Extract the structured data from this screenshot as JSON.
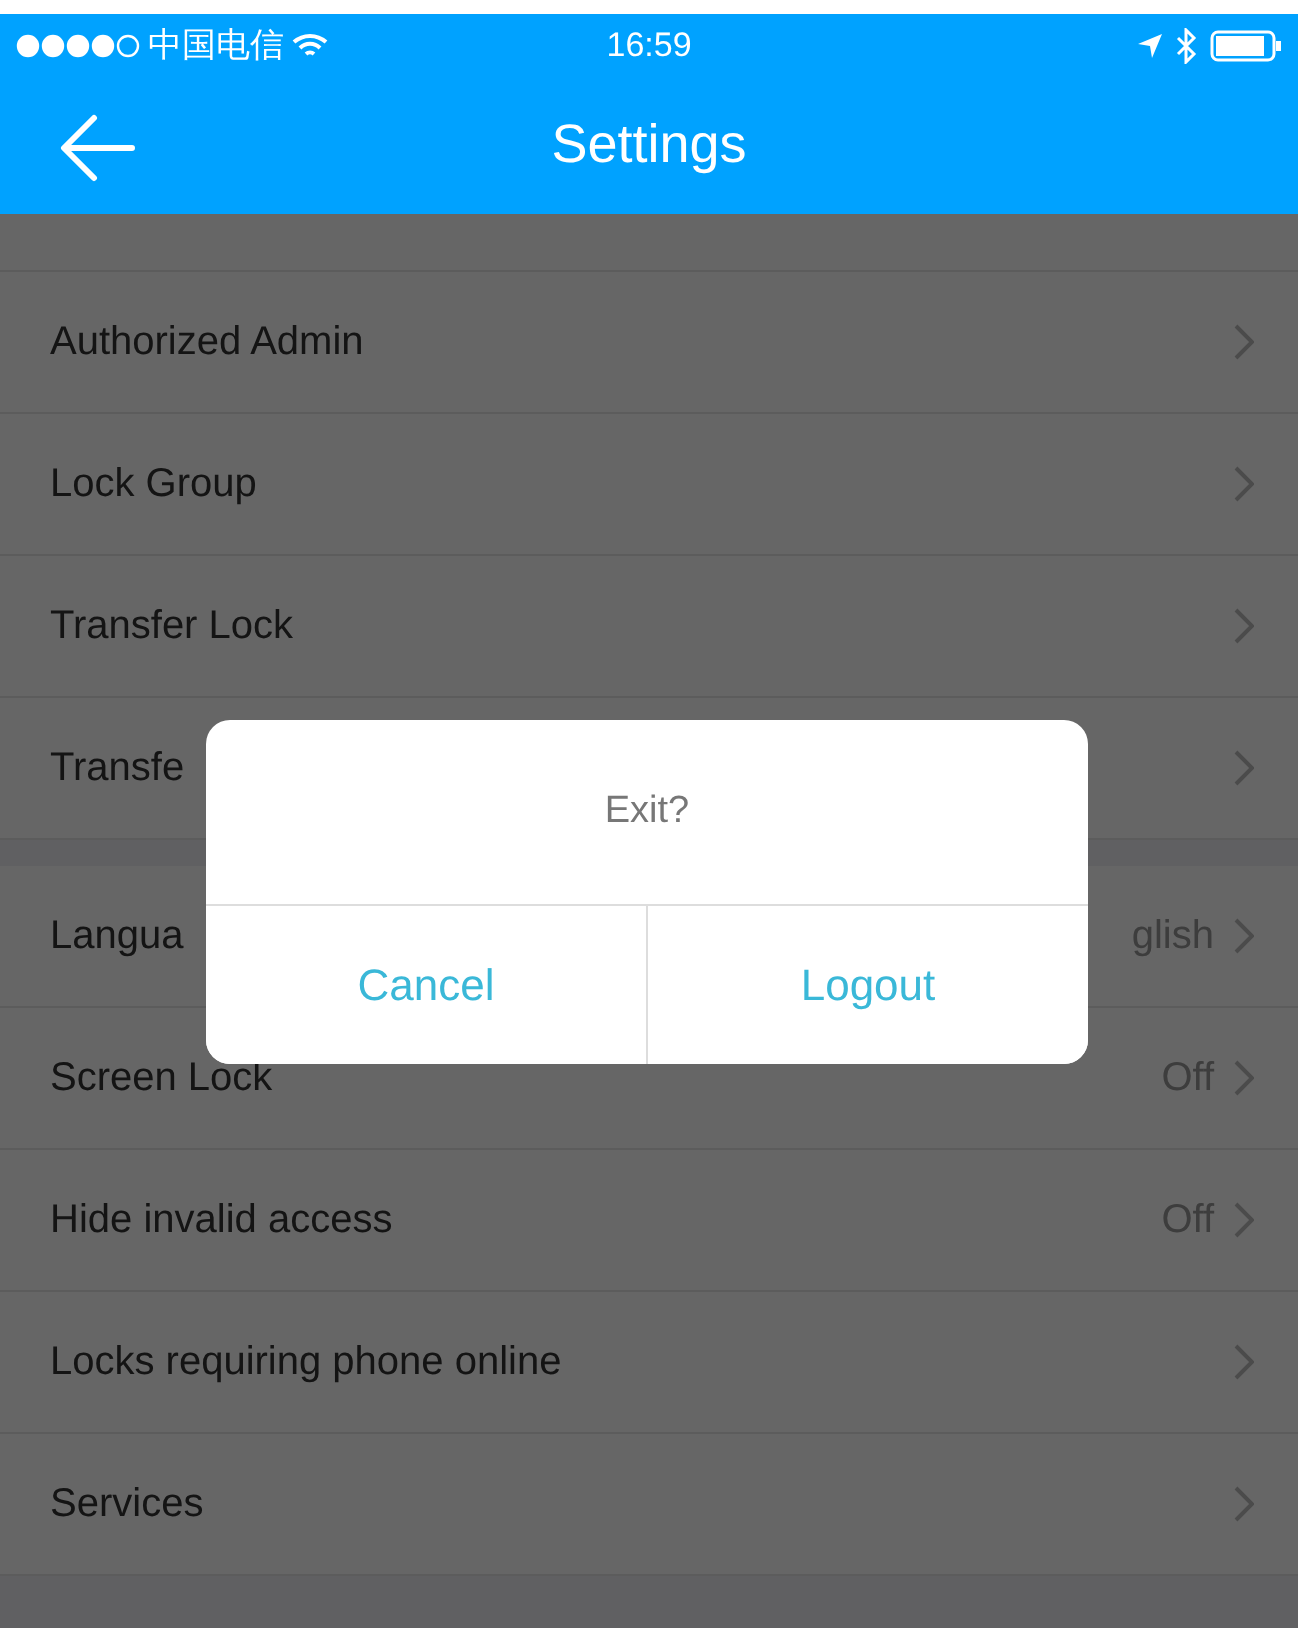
{
  "status_bar": {
    "carrier": "中国电信",
    "time": "16:59"
  },
  "header": {
    "title": "Settings"
  },
  "sections": [
    {
      "rows": [
        {
          "label": "Authorized Admin"
        },
        {
          "label": "Lock Group"
        },
        {
          "label": "Transfer Lock"
        },
        {
          "label": "Transfe"
        }
      ]
    },
    {
      "rows": [
        {
          "label": "Langua",
          "value": "glish"
        },
        {
          "label": "Screen Lock",
          "value": "Off"
        },
        {
          "label": "Hide invalid access",
          "value": "Off"
        },
        {
          "label": "Locks requiring phone online"
        },
        {
          "label": "Services"
        }
      ]
    }
  ],
  "dialog": {
    "title": "Exit?",
    "buttons": [
      "Cancel",
      "Logout"
    ]
  }
}
